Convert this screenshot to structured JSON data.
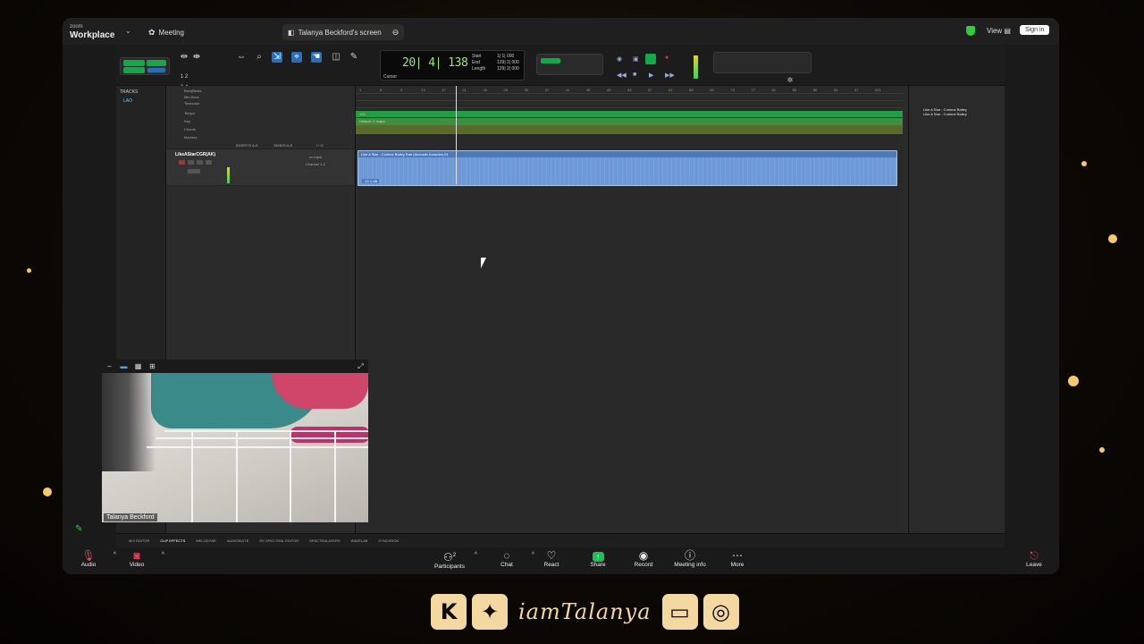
{
  "zoom": {
    "logo_line1": "zoom",
    "logo_line2": "Workplace",
    "tabs": [
      {
        "label": "Meeting"
      },
      {
        "label": "Talanya Beckford's screen"
      }
    ],
    "view_label": "View",
    "signin_label": "Sign in"
  },
  "daw": {
    "counter": {
      "main": "20| 4| 138",
      "start_label": "Start",
      "end_label": "End",
      "length_label": "Length",
      "start_value": "1| 1| 000",
      "end_value": "129| 2| 000",
      "length_value": "129| 2| 000",
      "cursor_label": "Cursor"
    },
    "tracks_header": "TRACKS",
    "track_list_item": "LAO",
    "ruler_names": [
      "Bars|Beats",
      "Min:Secs",
      "Timecode",
      "Tempo",
      "Key",
      "Chords",
      "Markers"
    ],
    "tempo_value": "120",
    "key_value": "Default: C major",
    "track_name": "LikeAStarCGR(AK)",
    "io_labels": [
      "INSERTS A-E",
      "SENDS A-E",
      "I / O"
    ],
    "io_input": "no input",
    "io_output": "Channel 1-2",
    "ruler_ticks": [
      "1",
      "5",
      "9",
      "13",
      "17",
      "21",
      "25",
      "29",
      "33",
      "37",
      "41",
      "45",
      "49",
      "53",
      "57",
      "61",
      "65",
      "69",
      "73",
      "77",
      "81",
      "85",
      "89",
      "93",
      "97",
      "101"
    ],
    "clip_name": "Like A Star - Corinne Bailey Rae (Acoustic Karaoke) 01",
    "clip_gain": "-15.1 dB",
    "clips_panel_items": [
      "Like A Star - Corinne Bailey",
      "Like A Star - Corinne Bailey"
    ],
    "bottom_tabs": [
      "MIX EDITOR",
      "CLIP EFFECTS",
      "MELODYNE",
      "AUDIOSUITE",
      "RX SPECTRAL EDITOR",
      "SPECTRALAYERS",
      "WAVELAB",
      "SYNCHRON"
    ]
  },
  "video": {
    "participant_name": "Talanya Beckford"
  },
  "controls": [
    {
      "label": "Audio"
    },
    {
      "label": "Video"
    },
    {
      "label": "Participants",
      "count": "2"
    },
    {
      "label": "Chat"
    },
    {
      "label": "React"
    },
    {
      "label": "Share"
    },
    {
      "label": "Record"
    },
    {
      "label": "Meeting info"
    },
    {
      "label": "More"
    },
    {
      "label": "Leave"
    }
  ],
  "branding": {
    "handle": "iamTalanya"
  }
}
